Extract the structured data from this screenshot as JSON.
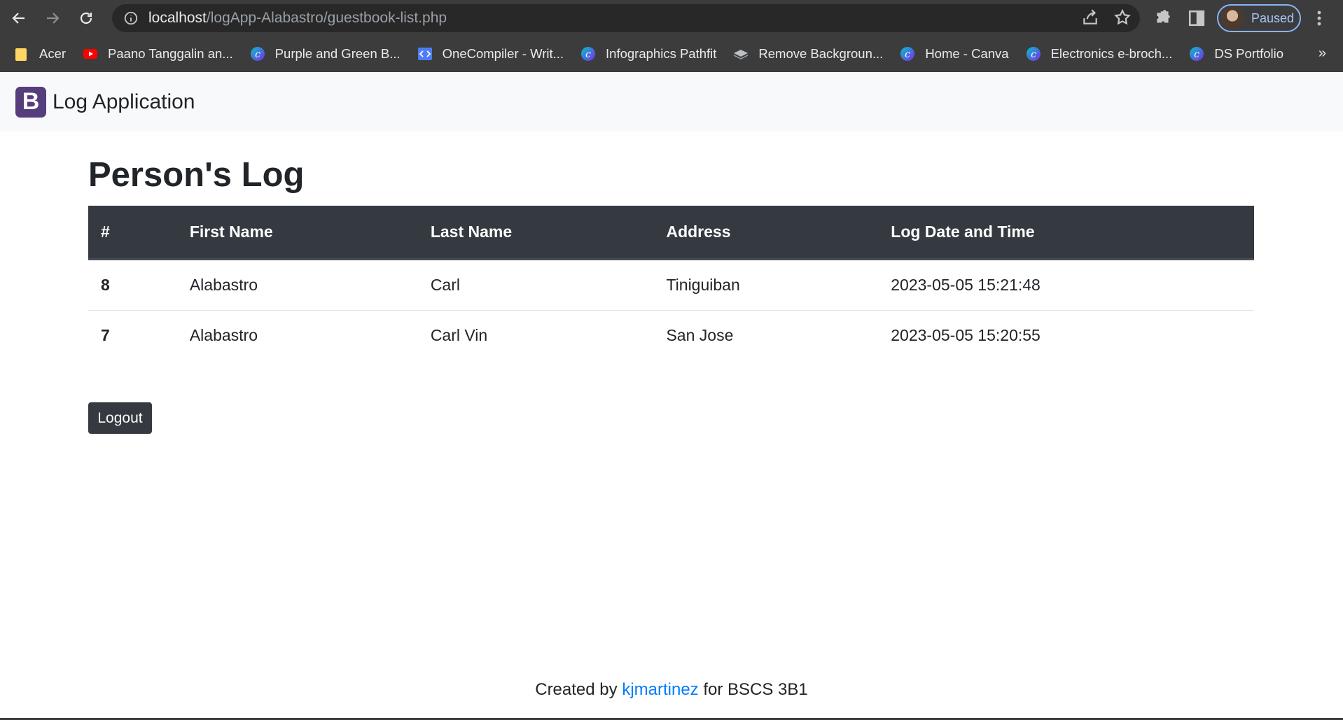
{
  "browser": {
    "url_host": "localhost",
    "url_path": "/logApp-Alabastro/guestbook-list.php",
    "profile_label": "Paused",
    "bookmarks": [
      {
        "label": "Acer",
        "icon": "folder-icon"
      },
      {
        "label": "Paano Tanggalin an...",
        "icon": "youtube-icon"
      },
      {
        "label": "Purple and Green B...",
        "icon": "canva-icon"
      },
      {
        "label": "OneCompiler - Writ...",
        "icon": "code-icon"
      },
      {
        "label": "Infographics Pathfit",
        "icon": "canva-icon"
      },
      {
        "label": "Remove Backgroun...",
        "icon": "layers-icon"
      },
      {
        "label": "Home - Canva",
        "icon": "canva-icon"
      },
      {
        "label": "Electronics e-broch...",
        "icon": "canva-icon"
      },
      {
        "label": "DS Portfolio",
        "icon": "canva-icon"
      }
    ],
    "more_label": "»"
  },
  "navbar": {
    "logo_letter": "B",
    "brand": "Log Application"
  },
  "main": {
    "title": "Person's Log",
    "table": {
      "headers": [
        "#",
        "First Name",
        "Last Name",
        "Address",
        "Log Date and Time"
      ],
      "rows": [
        [
          "8",
          "Alabastro",
          "Carl",
          "Tiniguiban",
          "2023-05-05 15:21:48"
        ],
        [
          "7",
          "Alabastro",
          "Carl Vin",
          "San Jose",
          "2023-05-05 15:20:55"
        ]
      ]
    },
    "logout_label": "Logout"
  },
  "footer": {
    "prefix": "Created by ",
    "link": "kjmartinez",
    "suffix": " for BSCS 3B1"
  },
  "colors": {
    "brand_purple": "#563d7c",
    "dark": "#343a40",
    "link_blue": "#007bff"
  }
}
